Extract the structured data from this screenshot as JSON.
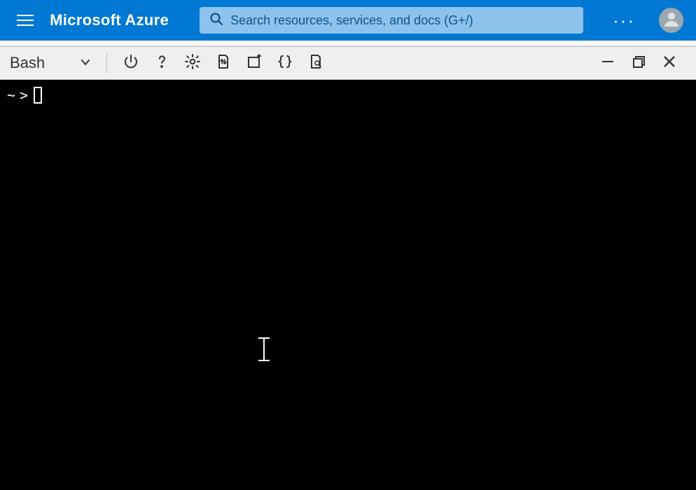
{
  "header": {
    "title": "Microsoft Azure",
    "search_placeholder": "Search resources, services, and docs (G+/)",
    "more_label": "···"
  },
  "shell": {
    "selected_shell": "Bash"
  },
  "terminal": {
    "prompt_cwd": "~",
    "prompt_separator": ">"
  }
}
